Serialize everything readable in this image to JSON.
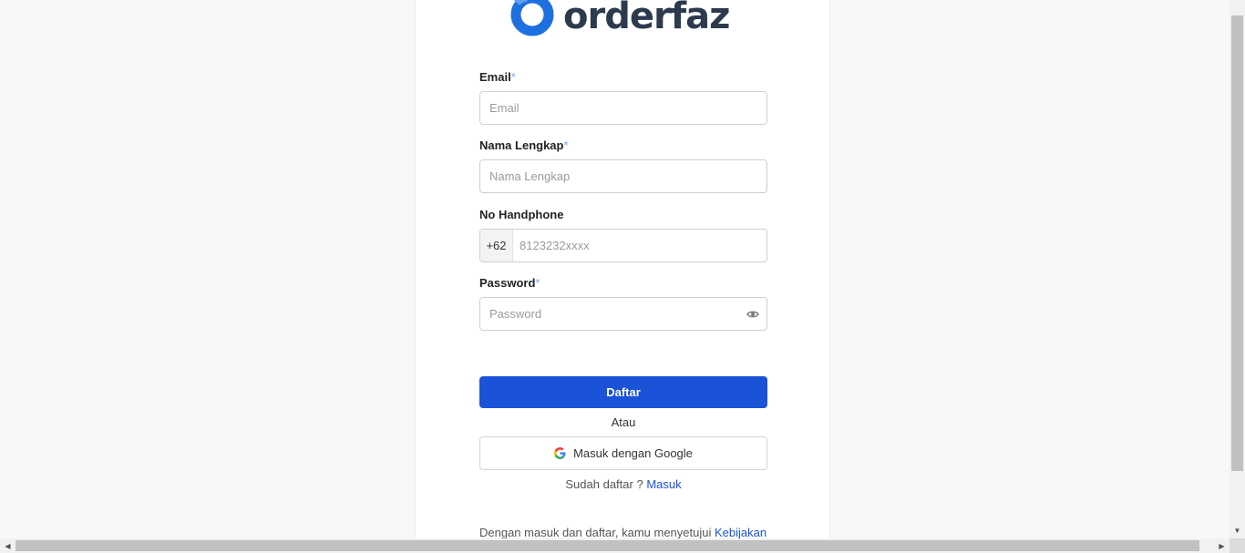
{
  "brand": {
    "name": "orderfaz"
  },
  "form": {
    "email": {
      "label": "Email",
      "required": "*",
      "placeholder": "Email"
    },
    "fullname": {
      "label": "Nama Lengkap",
      "required": "*",
      "placeholder": "Nama Lengkap"
    },
    "phone": {
      "label": "No Handphone",
      "prefix": "+62",
      "placeholder": "8123232xxxx"
    },
    "password": {
      "label": "Password",
      "required": "*",
      "placeholder": "Password",
      "toggle_icon": "eye-icon"
    }
  },
  "actions": {
    "register_label": "Daftar",
    "or_label": "Atau",
    "google_label": "Masuk dengan Google",
    "already_text": "Sudah daftar ?",
    "login_link": "Masuk"
  },
  "terms": {
    "text": "Dengan masuk dan daftar, kamu menyetujui",
    "link": "Kebijakan"
  },
  "colors": {
    "primary": "#1a53d8",
    "required_marker": "#7aa7ef",
    "logo_text": "#2d3a4e"
  }
}
